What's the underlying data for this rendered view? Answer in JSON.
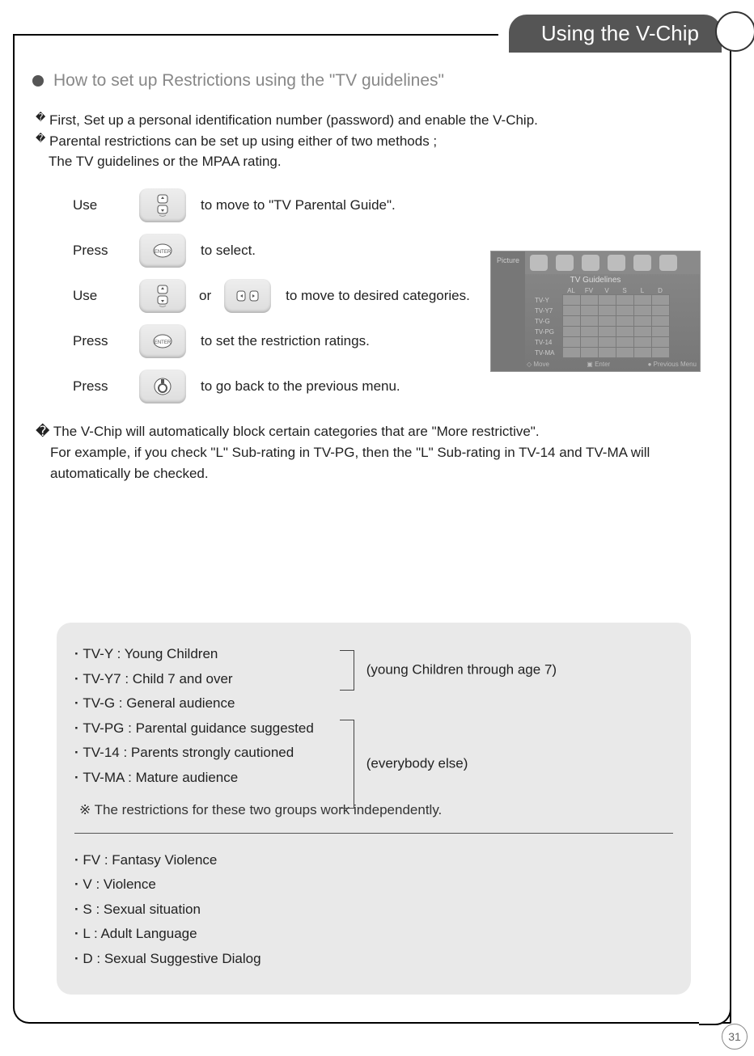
{
  "header": {
    "title": "Using the V-Chip"
  },
  "section": {
    "title": "How to set up Restrictions using the \"TV guidelines\"",
    "intro1_prefix": "�",
    "intro1": "First, Set up a personal identification number (password) and enable the V-Chip.",
    "intro2_prefix": "�",
    "intro2": "Parental restrictions can be set up using either of two methods ;",
    "intro2b": "The TV guidelines or the MPAA rating."
  },
  "steps": [
    {
      "label": "Use",
      "icon": "updown",
      "text": "to move to \"TV Parental Guide\"."
    },
    {
      "label": "Press",
      "icon": "enter",
      "text": "to select."
    },
    {
      "label": "Use",
      "icon": "updown",
      "or": "or",
      "icon2": "leftright",
      "text": "to move to desired categories."
    },
    {
      "label": "Press",
      "icon": "enter",
      "text": "to set the restriction ratings."
    },
    {
      "label": "Press",
      "icon": "menu-return",
      "text": "to go back to the previous menu."
    }
  ],
  "tvGuidelinesScreenshot": {
    "sideLabel": "Picture",
    "title": "TV Guidelines",
    "columns": [
      "AL",
      "FV",
      "V",
      "S",
      "L",
      "D"
    ],
    "rows": [
      "TV-Y",
      "TV-Y7",
      "TV-G",
      "TV-PG",
      "TV-14",
      "TV-MA"
    ],
    "hints": {
      "move": "Move",
      "enter": "Enter",
      "prev": "Previous Menu"
    }
  },
  "note": {
    "prefix": "�",
    "line1": "The V-Chip will automatically block certain categories that are \"More restrictive\".",
    "line2": "For example, if you check \"L\" Sub-rating in TV-PG, then the \"L\" Sub-rating in TV-14 and TV-MA will",
    "line3": "automatically be checked."
  },
  "definitions": {
    "groupA": [
      "TV-Y : Young Children",
      "TV-Y7 : Child 7 and over"
    ],
    "groupALabel": "(young Children through age 7)",
    "groupB": [
      "TV-G : General audience",
      "TV-PG : Parental guidance suggested",
      "TV-14 : Parents strongly cautioned",
      "TV-MA : Mature audience"
    ],
    "groupBLabel": "(everybody else)",
    "starNote": "※ The restrictions for these two groups work independently.",
    "subratings": [
      "FV : Fantasy Violence",
      "V : Violence",
      "S : Sexual situation",
      "L :  Adult Language",
      "D : Sexual Suggestive Dialog"
    ]
  },
  "pageNumber": "31"
}
